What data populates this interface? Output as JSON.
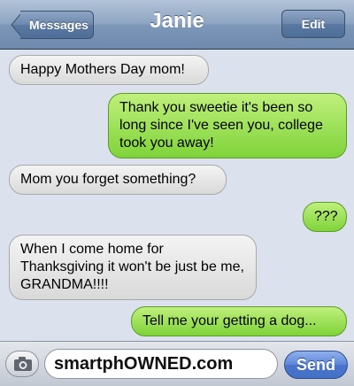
{
  "navbar": {
    "back_label": "Messages",
    "title": "Janie",
    "edit_label": "Edit"
  },
  "messages": [
    {
      "side": "received",
      "text": "Happy Mothers Day mom!"
    },
    {
      "side": "sent",
      "text": "Thank you sweetie it's been so long since I've seen you, college took you away!"
    },
    {
      "side": "received",
      "text": "Mom you forget something?"
    },
    {
      "side": "sent",
      "text": "???"
    },
    {
      "side": "received",
      "text": "When I come home for Thanksgiving it won't be just be me, GRANDMA!!!!"
    },
    {
      "side": "sent",
      "text": "Tell me your getting a dog..."
    }
  ],
  "input": {
    "value": "smartphOWNED.com",
    "send_label": "Send",
    "camera_icon": "camera-icon"
  },
  "colors": {
    "nav_blue": "#7d97b9",
    "sent_green": "#7fd33a",
    "received_gray": "#d9d9d9",
    "background": "#dbe2ed"
  }
}
